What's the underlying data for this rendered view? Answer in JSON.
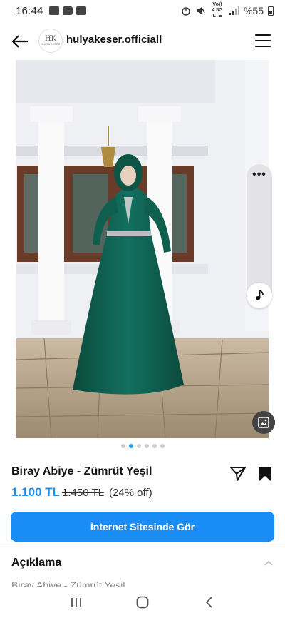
{
  "status_bar": {
    "time": "16:44",
    "network": "Vo)) 4.5G LTE",
    "battery": "%55"
  },
  "header": {
    "username": "hulyakeser.officiall",
    "avatar_monogram": "HK",
    "avatar_subtext": "HÜLYA KESER"
  },
  "gallery": {
    "page_count": 6,
    "active_index": 1
  },
  "product": {
    "title": "Biray Abiye - Zümrüt Yeşil",
    "price": "1.100 TL",
    "old_price": "1.450 TL",
    "discount": "(24% off)",
    "cta_label": "İnternet Sitesinde Gör"
  },
  "description": {
    "title": "Açıklama",
    "preview": "Biray Abiye - Zümrüt Yeşil"
  },
  "colors": {
    "accent": "#1a8cf5",
    "price": "#1d8ff0",
    "dress": "#0f5b4a"
  },
  "icons": [
    "back-arrow-icon",
    "menu-icon",
    "more-dots-icon",
    "music-note-icon",
    "gallery-icon",
    "share-icon",
    "bookmark-icon",
    "chevron-up-icon",
    "recents-icon",
    "home-icon",
    "back-icon"
  ]
}
